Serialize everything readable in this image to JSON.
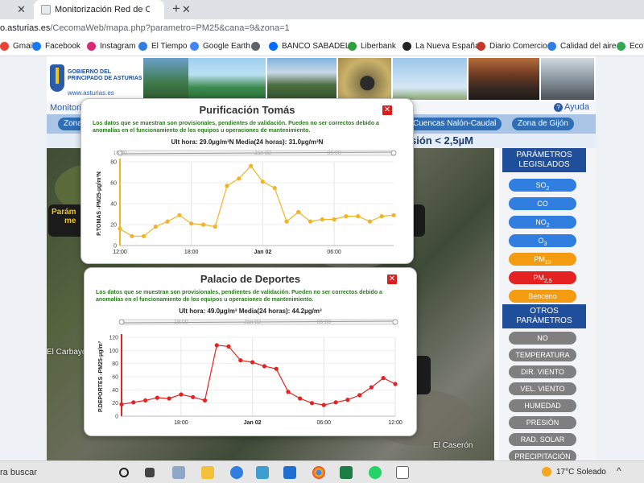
{
  "browser": {
    "prev_tab_close": "✕",
    "tab_title": "Monitorización Red de Calidad d",
    "tab_close": "✕",
    "new_tab": "+",
    "url_host": "o.asturias.es",
    "url_path": "/CecomaWeb/mapa.php?parametro=PM25&cana=9&zona=1",
    "bookmarks": [
      {
        "label": "Gmail",
        "icon": "gmail-icon",
        "color": "#ea4335"
      },
      {
        "label": "Facebook",
        "icon": "facebook-icon",
        "color": "#1877f2"
      },
      {
        "label": "Instagram",
        "icon": "instagram-icon",
        "color": "#d62976"
      },
      {
        "label": "El Tiempo",
        "icon": "weather-site-icon",
        "color": "#2f7ee0"
      },
      {
        "label": "Google Earth",
        "icon": "google-earth-icon",
        "color": "#4285f4"
      },
      {
        "label": "",
        "icon": "globe-icon",
        "color": "#5f6368"
      },
      {
        "label": "BANCO SABADELL",
        "icon": "sabadell-icon",
        "color": "#006dff"
      },
      {
        "label": "Liberbank",
        "icon": "liberbank-icon",
        "color": "#2e9e3e"
      },
      {
        "label": "La Nueva España",
        "icon": "lne-icon",
        "color": "#222222"
      },
      {
        "label": "Diario Comercio",
        "icon": "diario-comercio-icon",
        "color": "#c0392b"
      },
      {
        "label": "Calidad del aire",
        "icon": "calidad-aire-icon",
        "color": "#2f7ee0"
      },
      {
        "label": "Ecoti",
        "icon": "ecoti-icon",
        "color": "#34a853"
      }
    ]
  },
  "site": {
    "logo_line1": "GOBIERNO DEL",
    "logo_line2": "PRINCIPADO DE ASTURIAS",
    "logo_link": "www.asturias.es",
    "monitor_label": "Monitori",
    "help_label": "Ayuda",
    "zones": [
      "Zona",
      "Cuencas Nalón-Caudal",
      "Zona de Gijón"
    ],
    "param_title": "sión < 2,5µM",
    "map_labels": {
      "place1": "El Carbayón",
      "place2": "El Caserón",
      "sign1_a": "Parám",
      "sign1_b": "me"
    }
  },
  "sidebar": {
    "legislados_header": "PARÁMETROS LEGISLADOS",
    "legislados": [
      {
        "base": "SO",
        "sub": "2",
        "style": "blue"
      },
      {
        "base": "CO",
        "sub": "",
        "style": "blue"
      },
      {
        "base": "NO",
        "sub": "2",
        "style": "blue"
      },
      {
        "base": "O",
        "sub": "3",
        "style": "blue"
      },
      {
        "base": "PM",
        "sub": "10",
        "style": "orange"
      },
      {
        "base": "PM",
        "sub": "2,5",
        "style": "red"
      },
      {
        "base": "Benceno",
        "sub": "",
        "style": "orange"
      }
    ],
    "otros_header": "OTROS PARÁMETROS",
    "otros": [
      "NO",
      "TEMPERATURA",
      "DIR. VIENTO",
      "VEL. VIENTO",
      "HUMEDAD",
      "PRESIÓN",
      "RAD. SOLAR",
      "PRECIPITACIÓN"
    ]
  },
  "popups": [
    {
      "title": "Purificación Tomás",
      "close": "✕",
      "warning": "Los datos que se muestran son provisionales, pendientes de validación. Pueden no ser correctos debido a anomalías en el funcionamiento de los equipos u operaciones de mantenimiento.",
      "stats": "Ult hora: 29.0µg/m³N Media(24 horas): 31.0µg/m³N"
    },
    {
      "title": "Palacio de Deportes",
      "close": "✕",
      "warning": "Los datos que se muestran son provisionales, pendientes de validación. Pueden no ser correctos debido a anomalías en el funcionamiento de los equipos u operaciones de mantenimiento.",
      "stats": "Ult hora: 49.0µg/m³ Media(24 horas): 44.2µg/m³"
    }
  ],
  "chart_data": [
    {
      "type": "line",
      "ylabel": "P.TOMAS -PM25-µg/m³N",
      "ylim": [
        0,
        80
      ],
      "yticks": [
        0,
        20,
        40,
        60,
        80
      ],
      "xticks": [
        {
          "i": 0,
          "label": "12:00"
        },
        {
          "i": 6,
          "label": "18:00"
        },
        {
          "i": 12,
          "label": "Jan 02"
        },
        {
          "i": 18,
          "label": "06:00"
        }
      ],
      "navigator_labels": [
        {
          "i": 0,
          "label": "18:00"
        },
        {
          "i": 12,
          "label": "Jan 02"
        },
        {
          "i": 18,
          "label": "06:00"
        }
      ],
      "color": "#f5b324",
      "grid": true,
      "series": [
        {
          "values": [
            16,
            9,
            9,
            18,
            23,
            29,
            21,
            20,
            18,
            57,
            64,
            76,
            61,
            55,
            23,
            32,
            23,
            25,
            25,
            28,
            28,
            23,
            28,
            29
          ]
        }
      ]
    },
    {
      "type": "line",
      "ylabel": "P.DEPORTES -PM25-µg/m³",
      "ylim": [
        0,
        120
      ],
      "yticks": [
        0,
        20,
        40,
        60,
        80,
        100,
        120
      ],
      "xticks": [
        {
          "i": 5,
          "label": "18:00"
        },
        {
          "i": 11,
          "label": "Jan 02"
        },
        {
          "i": 17,
          "label": "06:00"
        },
        {
          "i": 23,
          "label": "12:00"
        }
      ],
      "navigator_labels": [
        {
          "i": 5,
          "label": "18:00"
        },
        {
          "i": 11,
          "label": "Jan 02"
        },
        {
          "i": 17,
          "label": "06:00"
        }
      ],
      "color": "#e52222",
      "grid": true,
      "series": [
        {
          "values": [
            18,
            21,
            24,
            28,
            27,
            33,
            29,
            24,
            108,
            106,
            85,
            82,
            76,
            72,
            37,
            27,
            20,
            17,
            21,
            25,
            32,
            44,
            58,
            49
          ]
        }
      ]
    }
  ],
  "taskbar": {
    "search": "ra buscar",
    "weather": "17°C Soleado",
    "tray": "^"
  }
}
